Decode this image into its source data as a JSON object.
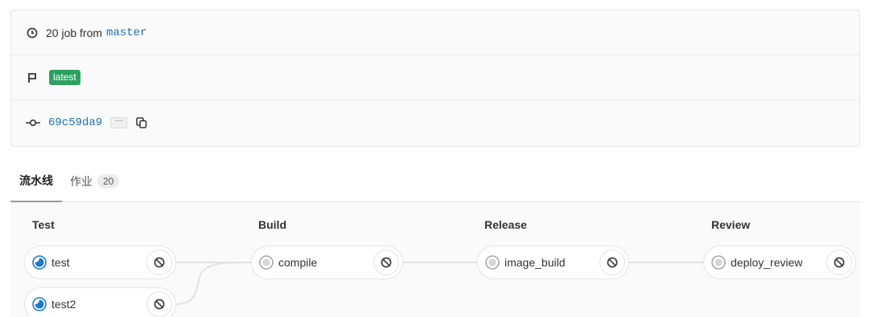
{
  "info": {
    "jobs_text": "20 job from",
    "branch": "master",
    "tag": "latest",
    "commit_sha": "69c59da9",
    "more_label": "···"
  },
  "tabs": {
    "pipeline": "流水线",
    "jobs": "作业",
    "jobs_count": "20"
  },
  "stages": [
    {
      "title": "Test",
      "jobs": [
        {
          "name": "test",
          "status": "running"
        },
        {
          "name": "test2",
          "status": "running"
        }
      ]
    },
    {
      "title": "Build",
      "jobs": [
        {
          "name": "compile",
          "status": "created"
        }
      ]
    },
    {
      "title": "Release",
      "jobs": [
        {
          "name": "image_build",
          "status": "created"
        }
      ]
    },
    {
      "title": "Review",
      "jobs": [
        {
          "name": "deploy_review",
          "status": "created"
        }
      ]
    }
  ],
  "colors": {
    "link": "#1f6fb5",
    "latest_badge": "#2da160",
    "running": "#1f78d1",
    "created": "#a7a7a7"
  },
  "icons": {
    "clock": "clock-icon",
    "flag": "flag-icon",
    "commit": "commit-icon",
    "copy": "copy-icon",
    "cancel": "cancel-icon"
  }
}
